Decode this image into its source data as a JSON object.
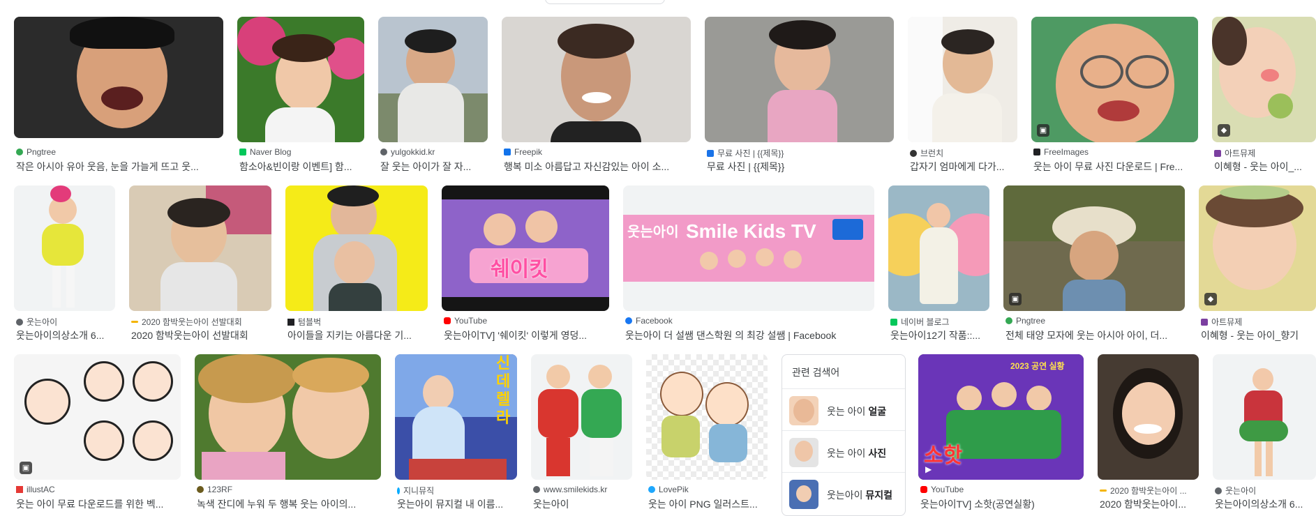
{
  "colors": {
    "source": "#4d5156",
    "title": "#3c4043",
    "border": "#dadce0"
  },
  "results": [
    {
      "source": "Pngtree",
      "title": "작은 아시아 유아 웃음, 눈을 가늘게 뜨고 웃...",
      "favicon_color": "#34a853"
    },
    {
      "source": "Naver Blog",
      "title": "함소아&빈이랑 이벤트] 함...",
      "favicon_color": "#03c75a"
    },
    {
      "source": "yulgokkid.kr",
      "title": "잘 웃는 아이가 잘 자...",
      "favicon_color": "#5f6368"
    },
    {
      "source": "Freepik",
      "title": "행복 미소 아름답고 자신감있는 아이 소...",
      "favicon_color": "#1273eb"
    },
    {
      "source": "무료 사진 | {{제목}}",
      "title": "무료 사진 | {{제목}}",
      "favicon_color": "#1a73e8"
    },
    {
      "source": "브런치",
      "title": "갑자기 엄마에게 다가...",
      "favicon_color": "#333333"
    },
    {
      "source": "FreeImages",
      "title": "웃는 아이 무료 사진 다운로드 | Fre...",
      "favicon_color": "#202124"
    },
    {
      "source": "아트뮤제",
      "title": "이혜형 - 웃는 아이_...",
      "favicon_color": "#7b3fa0"
    },
    {
      "source": "웃는아이",
      "title": "웃는아이의상소개 6...",
      "favicon_color": "#5f6368"
    },
    {
      "source": "2020 함박웃는아이 선발대회",
      "title": "2020 함박웃는아이 선발대회",
      "favicon_color": "#f4b400"
    },
    {
      "source": "텀블벅",
      "title": "아이들을 지키는 아름다운 기...",
      "favicon_color": "#202124"
    },
    {
      "source": "YouTube",
      "title": "웃는아이TV] '쉐이킷' 이렇게 영덩...",
      "favicon_color": "#ff0000"
    },
    {
      "source": "Facebook",
      "title": "웃는아이 더 설쌤 댄스학원 의 최강 설쌤 | Facebook",
      "favicon_color": "#1877f2"
    },
    {
      "source": "네이버 블로그",
      "title": "웃는아이12기 작품::...",
      "favicon_color": "#03c75a"
    },
    {
      "source": "Pngtree",
      "title": "전체 태양 모자에 웃는 아시아 아이, 더...",
      "favicon_color": "#34a853"
    },
    {
      "source": "아트뮤제",
      "title": "이혜형 - 웃는 아이_향기",
      "favicon_color": "#7b3fa0"
    },
    {
      "source": "illustAC",
      "title": "웃는 아이 무료 다운로드를 위한 벡...",
      "favicon_color": "#e53935"
    },
    {
      "source": "123RF",
      "title": "녹색 잔디에 누워 두 행복 웃는 아이의...",
      "favicon_color": "#6b5b1e"
    },
    {
      "source": "지니뮤직",
      "title": "웃는아이 뮤지컬 내 이름...",
      "favicon_color": "#00aaff"
    },
    {
      "source": "www.smilekids.kr",
      "title": "웃는아이",
      "favicon_color": "#5f6368"
    },
    {
      "source": "LovePik",
      "title": "웃는 아이 PNG 일러스트...",
      "favicon_color": "#1ea7fd"
    },
    {
      "source": "YouTube",
      "title": "웃는아이TV] 소핫(공연실황)",
      "favicon_color": "#ff0000"
    },
    {
      "source": "2020 함박웃는아이 ...",
      "title": "2020 함박웃는아이...",
      "favicon_color": "#f4b400"
    },
    {
      "source": "웃는아이",
      "title": "웃는아이의상소개 6...",
      "favicon_color": "#5f6368"
    }
  ],
  "image_text": {
    "freepik_logo": "Smile Kids TV",
    "prefix": "웃는아이",
    "shakeit": "쉐이킷",
    "cinderella": "신데렐라",
    "sohot": "소핫",
    "live": "2023 공연 실황"
  },
  "related": {
    "title": "관련 검색어",
    "items": [
      {
        "prefix": "웃는 아이 ",
        "bold": "얼굴"
      },
      {
        "prefix": "웃는 아이 ",
        "bold": "사진"
      },
      {
        "prefix": "웃는아이 ",
        "bold": "뮤지컬"
      }
    ]
  }
}
